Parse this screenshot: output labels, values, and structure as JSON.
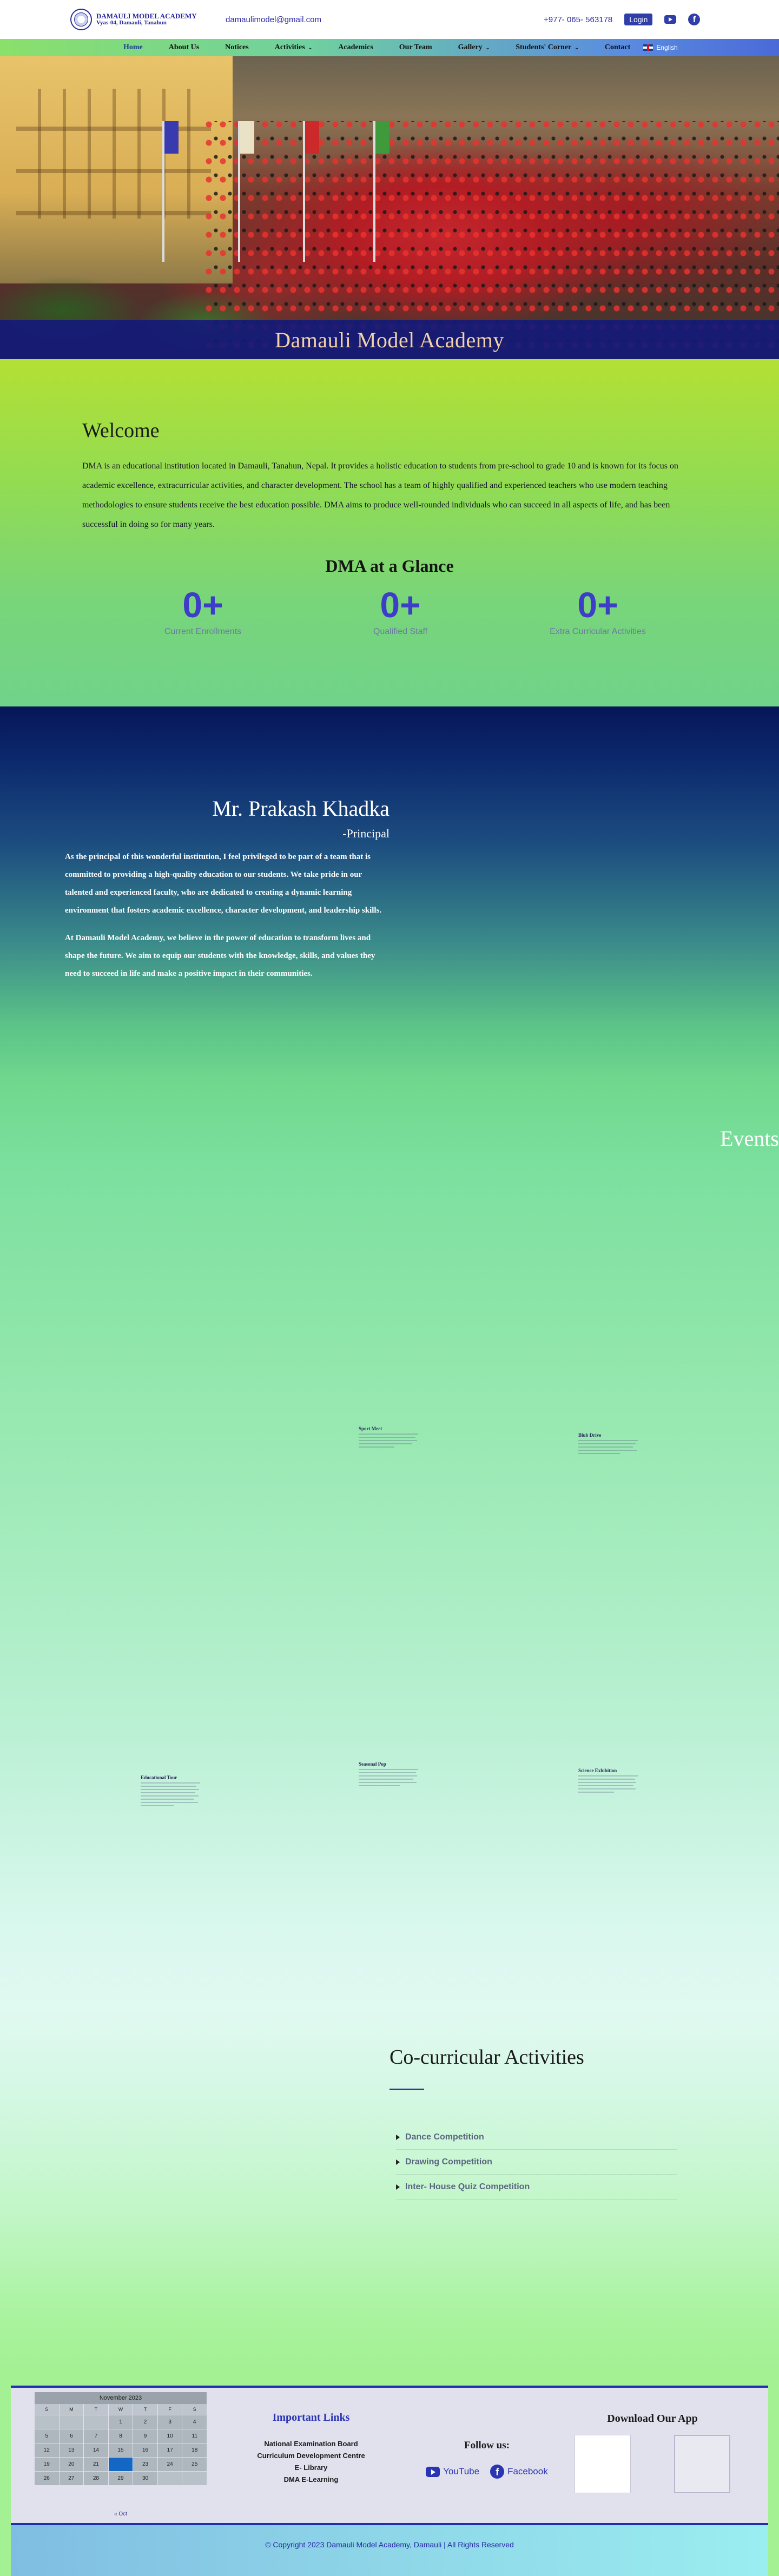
{
  "header": {
    "school_name": "DAMAULI MODEL ACADEMY",
    "address": "Vyas-04, Damauli, Tanahun",
    "email": "damaulimodel@gmail.com",
    "phone": "+977- 065- 563178",
    "login_label": "Login",
    "icons": [
      "youtube-icon",
      "facebook-icon"
    ]
  },
  "nav": {
    "items": [
      {
        "label": "Home",
        "dropdown": false
      },
      {
        "label": "About Us",
        "dropdown": false
      },
      {
        "label": "Notices",
        "dropdown": false
      },
      {
        "label": "Activities",
        "dropdown": true
      },
      {
        "label": "Academics",
        "dropdown": false
      },
      {
        "label": "Our Team",
        "dropdown": false
      },
      {
        "label": "Gallery",
        "dropdown": true
      },
      {
        "label": "Students' Corner",
        "dropdown": true
      },
      {
        "label": "Contact",
        "dropdown": false
      }
    ],
    "active": "Home",
    "language": "English"
  },
  "hero": {
    "title": "Damauli Model Academy"
  },
  "welcome": {
    "heading": "Welcome",
    "text": "DMA is an educational institution located in Damauli, Tanahun, Nepal. It provides a holistic education to students from pre-school to grade 10 and is known for its focus on academic excellence, extracurricular activities, and character development. The school has a team of highly qualified and experienced teachers who use modern teaching methodologies to ensure students receive the best education possible. DMA aims to produce well-rounded individuals who can succeed in all aspects of life, and has been successful in doing so for many years."
  },
  "glance": {
    "title": "DMA at a Glance",
    "stats": [
      {
        "value": "0+",
        "label": "Current Enrollments"
      },
      {
        "value": "0+",
        "label": "Qualified Staff"
      },
      {
        "value": "0+",
        "label": "Extra Curricular Activities"
      }
    ]
  },
  "principal": {
    "name": "Mr. Prakash Khadka",
    "role": "-Principal",
    "para1": "As the principal of this wonderful institution, I feel privileged to be part of a team that is committed to providing a high-quality education to our students. We take pride in our talented and experienced faculty, who are dedicated to creating a dynamic learning environment that fosters academic excellence, character development, and leadership skills.",
    "para2": "At Damauli Model Academy, we believe in the power of education to transform lives and shape the future. We aim to equip our students with the knowledge, skills, and values they need to succeed in life and make a positive impact in their communities."
  },
  "events": {
    "heading": "Events",
    "cards": [
      {
        "title": "Sport Meet"
      },
      {
        "title": "Blub Drive"
      },
      {
        "title": "Educational Tour"
      },
      {
        "title": "Seasonal Pop"
      },
      {
        "title": "Science Exhibition"
      }
    ]
  },
  "cocurricular": {
    "heading": "Co-curricular Activities",
    "items": [
      "Dance Competition",
      "Drawing Competition",
      "Inter- House Quiz Competition"
    ]
  },
  "footer": {
    "calendar": {
      "month": "November 2023",
      "days_of_week": [
        "S",
        "M",
        "T",
        "W",
        "T",
        "F",
        "S"
      ],
      "leading_blank": 3,
      "days": [
        "1",
        "2",
        "3",
        "4",
        "5",
        "6",
        "7",
        "8",
        "9",
        "10",
        "11",
        "12",
        "13",
        "14",
        "15",
        "16",
        "17",
        "18",
        "19",
        "20",
        "21",
        "22",
        "23",
        "24",
        "25",
        "26",
        "27",
        "28",
        "29",
        "30"
      ],
      "today": "22",
      "prev_label": "« Oct"
    },
    "important_links": {
      "heading": "Important Links",
      "items": [
        "National Examination Board",
        "Curriculum Development Centre",
        "E- Library",
        "DMA E-Learning"
      ]
    },
    "follow": {
      "heading": "Follow us:",
      "youtube": "YouTube",
      "facebook": "Facebook"
    },
    "app": {
      "heading": "Download Our App"
    },
    "copyright": "© Copyright 2023 Damauli Model Academy, Damauli | All Rights Reserved"
  }
}
